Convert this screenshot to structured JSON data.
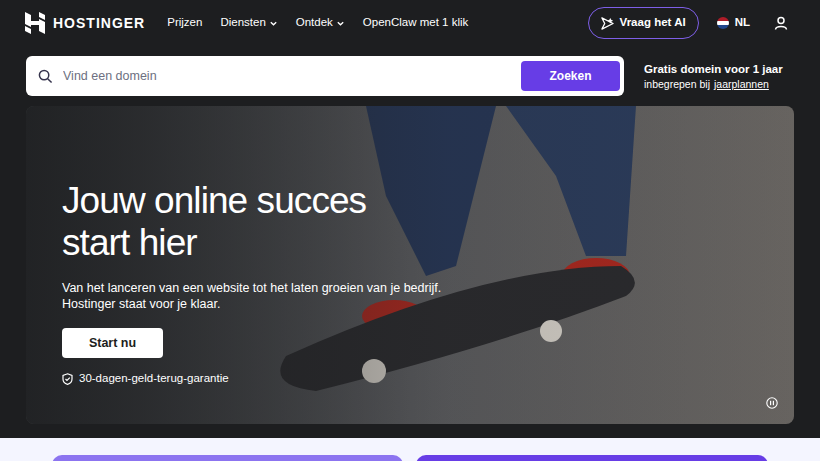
{
  "nav": {
    "logo": "HOSTINGER",
    "items": [
      {
        "label": "Prijzen",
        "dropdown": false
      },
      {
        "label": "Diensten",
        "dropdown": true
      },
      {
        "label": "Ontdek",
        "dropdown": true
      },
      {
        "label": "OpenClaw met 1 klik",
        "dropdown": false
      }
    ],
    "ai_button": "Vraag het AI",
    "language": "NL"
  },
  "search": {
    "placeholder": "Vind een domein",
    "button": "Zoeken"
  },
  "promo": {
    "title": "Gratis domein voor 1 jaar",
    "text": "inbegrepen bij",
    "link": "jaarplannen"
  },
  "hero": {
    "title": "Jouw online succes start hier",
    "text": "Van het lanceren van een website tot het laten groeien van je bedrijf. Hostinger staat voor je klaar.",
    "button": "Start nu",
    "guarantee": "30-dagen-geld-terug-garantie"
  }
}
